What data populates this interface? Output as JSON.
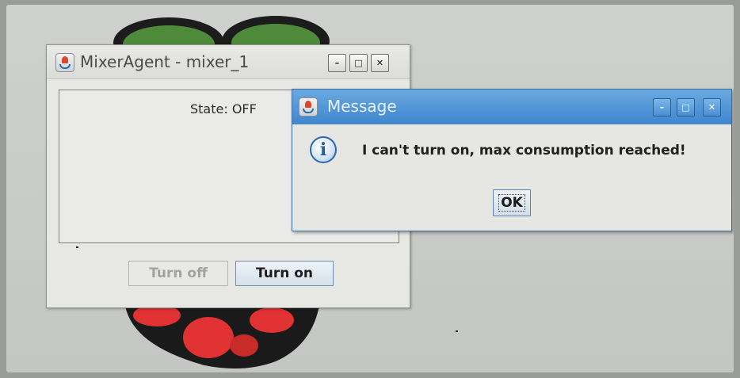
{
  "mixer_window": {
    "title": "MixerAgent - mixer_1",
    "icon": "java-icon",
    "controls": {
      "minimize": "–",
      "maximize": "□",
      "close": "✕"
    },
    "state_label": "State: OFF",
    "buttons": {
      "turn_off": "Turn off",
      "turn_on": "Turn on"
    }
  },
  "message_dialog": {
    "title": "Message",
    "icon": "java-icon",
    "info_icon": "i",
    "controls": {
      "minimize": "–",
      "maximize": "□",
      "close": "✕"
    },
    "message": "I can't turn on, max consumption reached!",
    "ok_label": "OK"
  },
  "colors": {
    "dialog_titlebar": "#4a8fd4",
    "logo_leaf": "#4e8a3a",
    "logo_berry": "#e03232"
  }
}
